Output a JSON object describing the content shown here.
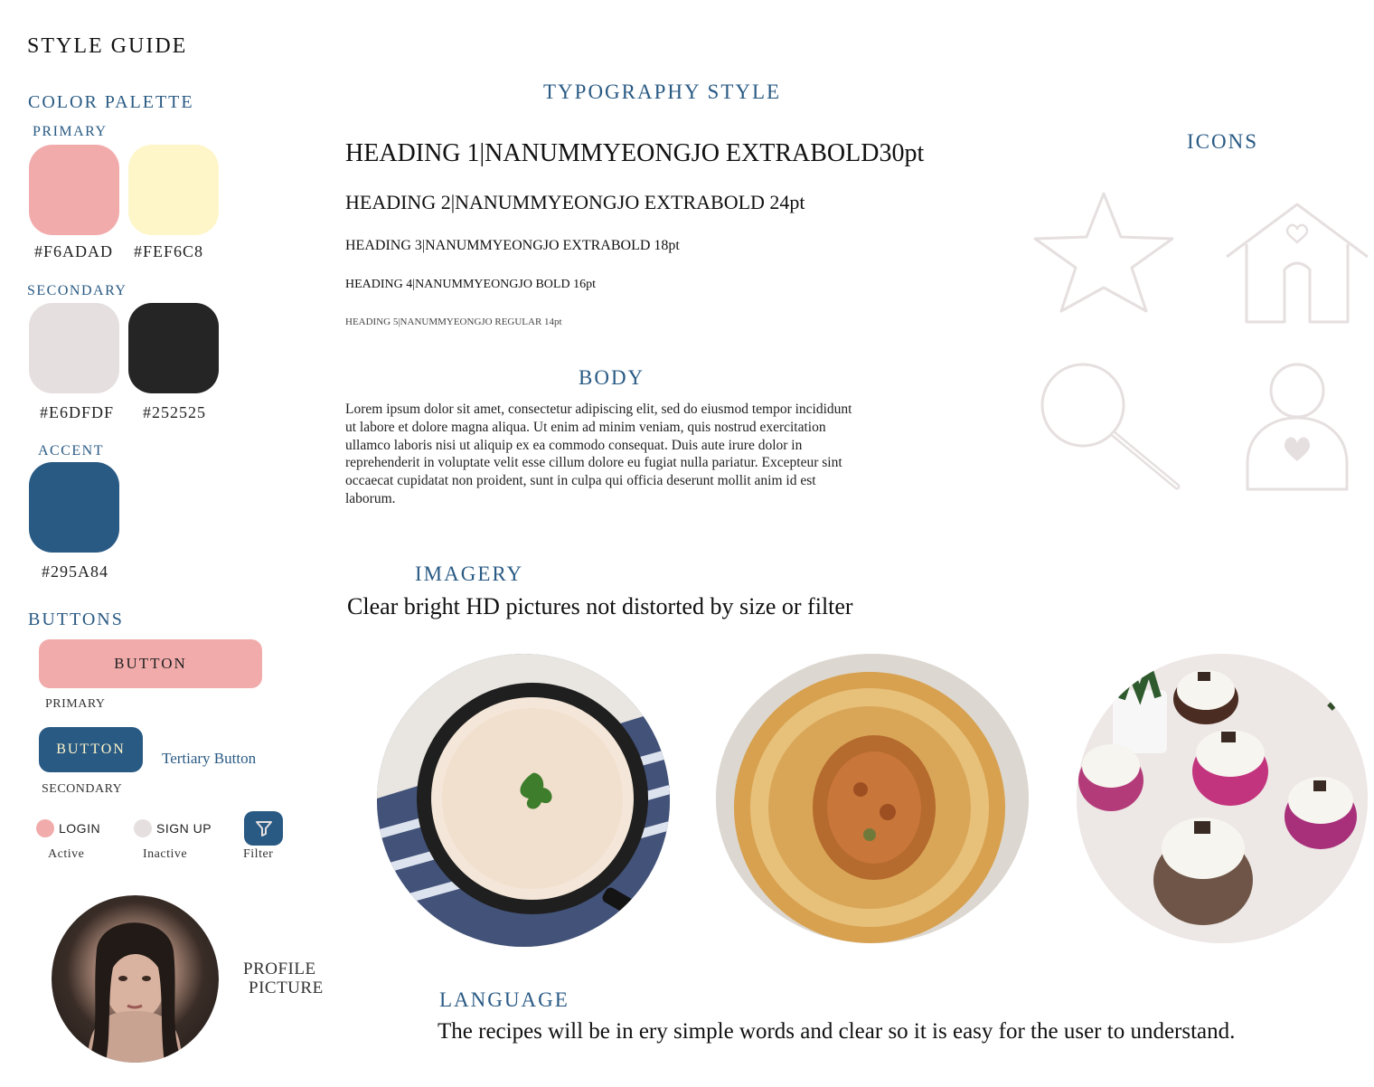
{
  "page_title": "STYLE GUIDE",
  "color_palette": {
    "title": "COLOR PALETTE",
    "primary": {
      "label": "PRIMARY",
      "swatches": [
        {
          "hex": "#F6ADAD",
          "color": "#F2ABAB"
        },
        {
          "hex": "#FEF6C8",
          "color": "#FEF6C8"
        }
      ]
    },
    "secondary": {
      "label": "SECONDARY",
      "swatches": [
        {
          "hex": "#E6DFDF",
          "color": "#E6DFDF"
        },
        {
          "hex": "#252525",
          "color": "#252525"
        }
      ]
    },
    "accent": {
      "label": "ACCENT",
      "swatches": [
        {
          "hex": "#295A84",
          "color": "#295A84"
        }
      ]
    }
  },
  "buttons": {
    "title": "BUTTONS",
    "primary_label": "BUTTON",
    "primary_caption": "PRIMARY",
    "secondary_label": "BUTTON",
    "secondary_caption": "SECONDARY",
    "tertiary_label": "Tertiary Button",
    "login_label": "LOGIN",
    "login_caption": "Active",
    "signup_label": "SIGN UP",
    "signup_caption": "Inactive",
    "filter_caption": "Filter"
  },
  "profile": {
    "caption_line1": "PROFILE",
    "caption_line2": "PICTURE"
  },
  "typography": {
    "title": "TYPOGRAPHY STYLE",
    "h1": "HEADING 1|NANUMMYEONGJO EXTRABOLD30pt",
    "h2": "HEADING 2|NANUMMYEONGJO EXTRABOLD 24pt",
    "h3": "HEADING 3|NANUMMYEONGJO EXTRABOLD 18pt",
    "h4": "HEADING 4|NANUMMYEONGJO BOLD 16pt",
    "h5": "HEADING 5|NANUMMYEONGJO REGULAR 14pt"
  },
  "body": {
    "title": "BODY",
    "text": "Lorem ipsum dolor sit amet, consectetur adipiscing elit, sed do eiusmod tempor incididunt ut labore et dolore magna aliqua. Ut enim ad minim veniam, quis nostrud exercitation ullamco laboris nisi ut aliquip ex ea commodo consequat. Duis aute irure dolor in reprehenderit in voluptate velit esse cillum dolore eu fugiat nulla pariatur. Excepteur sint occaecat cupidatat non proident, sunt in culpa qui officia deserunt mollit anim id est laborum."
  },
  "icons": {
    "title": "ICONS",
    "items": [
      "star-icon",
      "home-icon",
      "search-icon",
      "user-icon"
    ]
  },
  "imagery": {
    "title": "IMAGERY",
    "description": "Clear bright HD pictures not distorted by size or filter",
    "photos": [
      "soup-photo",
      "bread-bowl-photo",
      "cupcakes-photo"
    ]
  },
  "language": {
    "title": "LANGUAGE",
    "text": "The recipes will be in ery simple words and clear so it is easy for the user to understand."
  }
}
